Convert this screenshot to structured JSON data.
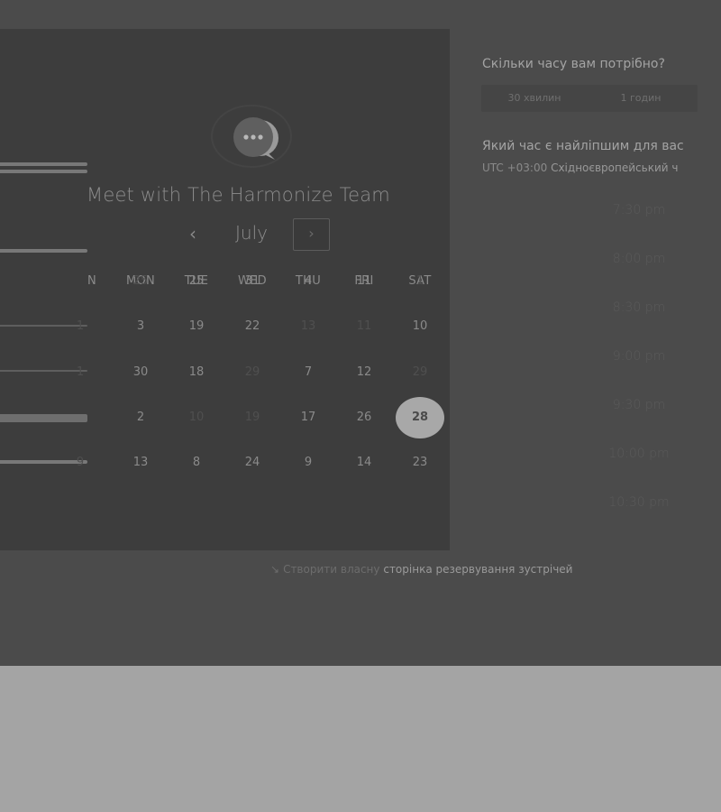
{
  "calendar": {
    "title": "Meet with The Harmonize Team",
    "month": "July",
    "prev_icon": "‹",
    "next_icon": "›",
    "weekdays": [
      "N",
      "MON",
      "TUE",
      "WED",
      "THU",
      "FRI",
      "SAT"
    ],
    "weeks": [
      [
        {
          "d": "25",
          "dim": true
        },
        {
          "d": "25"
        },
        {
          "d": "31"
        },
        {
          "d": "4"
        },
        {
          "d": "11"
        },
        {
          "d": "1",
          "dim": true
        }
      ],
      [
        {
          "d": "3"
        },
        {
          "d": "19"
        },
        {
          "d": "22"
        },
        {
          "d": "13",
          "dim": true
        },
        {
          "d": "11",
          "dim": true
        },
        {
          "d": "10"
        }
      ],
      [
        {
          "d": "30"
        },
        {
          "d": "18"
        },
        {
          "d": "29",
          "dim": true
        },
        {
          "d": "7"
        },
        {
          "d": "12"
        },
        {
          "d": "29",
          "dim": true
        }
      ],
      [
        {
          "d": "2"
        },
        {
          "d": "10",
          "dim": true
        },
        {
          "d": "19",
          "dim": true
        },
        {
          "d": "17"
        },
        {
          "d": "26"
        },
        {
          "d": "28",
          "selected": true
        }
      ],
      [
        {
          "d": "13"
        },
        {
          "d": "8"
        },
        {
          "d": "24"
        },
        {
          "d": "9"
        },
        {
          "d": "14"
        },
        {
          "d": "23"
        }
      ]
    ],
    "partial_col_days": [
      "",
      "1",
      "1",
      "",
      "9"
    ],
    "icons": {
      "logo": "chat-bubble-logo-icon"
    }
  },
  "duration": {
    "question": "Скільки часу вам потрібно?",
    "options": [
      "30 хвилин",
      "1 годин"
    ]
  },
  "time": {
    "question": "Який час є найліпшим для вас",
    "tz_offset": "UTC +03:00",
    "tz_name": "Східноєвропейський ч",
    "slots": [
      "7:30 pm",
      "8:00 pm",
      "8:30 pm",
      "9:00 pm",
      "9:30 pm",
      "10:00 pm",
      "10:30 pm"
    ]
  },
  "footer": {
    "icon": "↘",
    "prefix": "Створити власну",
    "link": "сторінка резервування зустрічей"
  },
  "colors": {
    "panel": "#3d3d3d",
    "background": "#4b4b4b",
    "selected_day": "#a8a8a8"
  }
}
